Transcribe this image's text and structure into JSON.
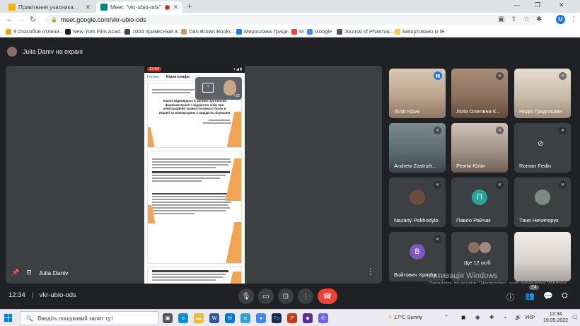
{
  "browser": {
    "tabs": [
      {
        "title": "Привітання учасникам студент"
      },
      {
        "title": "Meet: \"vkr-ubio-ods\""
      }
    ],
    "url": "meet.google.com/vkr-ubio-ods",
    "profile_initial": "M",
    "bookmarks": [
      {
        "label": "9 способов отличи...",
        "color": "#e8a317"
      },
      {
        "label": "New York Film Acad...",
        "color": "#1f1f1f"
      },
      {
        "label": "1004 примєсный а...",
        "color": "#444444"
      },
      {
        "label": "Dan Brown Books...",
        "color": "#c0a060"
      },
      {
        "label": "Мирослава Грици...",
        "color": "#1877f2"
      },
      {
        "label": "M",
        "color": "#ea4335"
      },
      {
        "label": "Google",
        "color": "#4285f4"
      },
      {
        "label": "Journal of Pharmac...",
        "color": "#555555"
      },
      {
        "label": "Імпортовано із IE",
        "color": "#f2c94c"
      }
    ]
  },
  "meet": {
    "presenting_label": "Julia Daniv на екрані",
    "stage_name": "Julia Daniv",
    "document": {
      "clock": "12:34",
      "done_label": "Готово",
      "title_label": "Кірик конфе",
      "pip_count": "+22",
      "slide1_title": "Аналіз відповідності чинних протоколів фармакотерапії з відкритих ліків при пенетраційній травмі головного болю в Україні та міжнародних стандартів лікування"
    },
    "participants": [
      {
        "name": "Лілія Кірик",
        "type": "video",
        "speaking": true,
        "color": "#b9a18a"
      },
      {
        "name": "Лілія Олегівна К...",
        "type": "video",
        "muted": true,
        "color": "#8a6f5d"
      },
      {
        "name": "Надія Гридчишин",
        "type": "video",
        "muted": true,
        "color": "#c8b9a6"
      },
      {
        "name": "Andrew Zastrizh...",
        "type": "video",
        "muted": true,
        "color": "#5b6a6e"
      },
      {
        "name": "Резнік Юлія",
        "type": "video",
        "muted": true,
        "color": "#9f8e83"
      },
      {
        "name": "Roman Fedin",
        "type": "camoff",
        "muted": true
      },
      {
        "name": "Nazariy Pokhodylo",
        "type": "avatar",
        "muted": true,
        "color": "#6d4c41",
        "initial": ""
      },
      {
        "name": "Павло Райчак",
        "type": "avatar",
        "muted": true,
        "color": "#26a69a",
        "initial": "П"
      },
      {
        "name": "Таня Нечипорук",
        "type": "avatar",
        "muted": true,
        "color": "#7b8c7e",
        "initial": ""
      },
      {
        "name": "Войтович Христи...",
        "type": "avatar",
        "muted": true,
        "color": "#7e57c2",
        "initial": "В"
      },
      {
        "name": "Ще 12 осіб",
        "type": "more"
      },
      {
        "name": "",
        "type": "video",
        "color": "#d7d2cc"
      }
    ],
    "bottom": {
      "time": "12:34",
      "separator": "|",
      "meeting_code": "vkr-ubio-ods",
      "people_count": "24"
    },
    "watermark": {
      "line1": "Активація Windows",
      "line2": "Перейдіть до розділу \"Настройки\", щоб активувати Windows."
    }
  },
  "taskbar": {
    "search_placeholder": "Введіть пошуковий запит тут",
    "weather": "17°C Sunny",
    "language": "УКР",
    "time": "12:34",
    "date": "19.05.2022",
    "apps": [
      {
        "icon": "task-view-icon",
        "color": "#555555",
        "glyph": "▣"
      },
      {
        "icon": "edge-icon",
        "color": "#0c8fce",
        "glyph": "e"
      },
      {
        "icon": "file-explorer-icon",
        "color": "#f2b83a",
        "glyph": "▬"
      },
      {
        "icon": "word-icon",
        "color": "#2b579a",
        "glyph": "W"
      },
      {
        "icon": "mail-icon",
        "color": "#0078d4",
        "glyph": "✉"
      },
      {
        "icon": "edge-icon",
        "color": "#34a0d8",
        "glyph": "e"
      },
      {
        "icon": "chrome-icon",
        "color": "#4285f4",
        "glyph": "●"
      },
      {
        "icon": "photoshop-icon",
        "color": "#1c2a4a",
        "glyph": "Ps"
      },
      {
        "icon": "powerpoint-icon",
        "color": "#c43e1c",
        "glyph": "P"
      },
      {
        "icon": "onedrive-icon",
        "color": "#5c2d91",
        "glyph": "◆"
      },
      {
        "icon": "viber-icon",
        "color": "#7360f2",
        "glyph": "✆"
      }
    ]
  }
}
